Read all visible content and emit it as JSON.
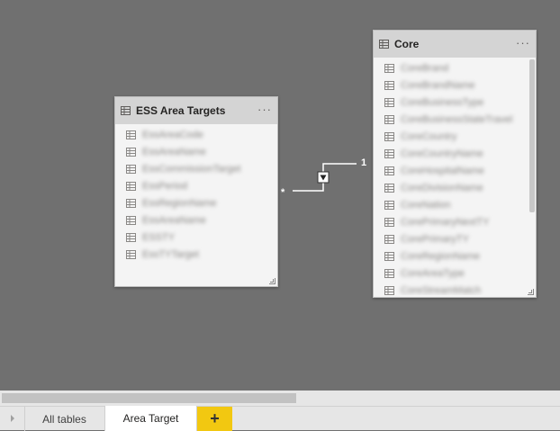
{
  "tables": [
    {
      "id": "ess",
      "title": "ESS Area Targets",
      "menu_label": "···",
      "fields": [
        "EssAreaCode",
        "EssAreaName",
        "EssCommissionTarget",
        "EssPeriod",
        "EssRegionName",
        "EssAreaName",
        "ESSTY",
        "EssTYTarget"
      ]
    },
    {
      "id": "core",
      "title": "Core",
      "menu_label": "···",
      "fields": [
        "CoreBrand",
        "CoreBrandName",
        "CoreBusinessType",
        "CoreBusinessStateTravel",
        "CoreCountry",
        "CoreCountryName",
        "CoreHospitalName",
        "CoreDivisionName",
        "CoreNation",
        "CorePrimaryNextTY",
        "CorePrimaryTY",
        "CoreRegionName",
        "CoreAreaType",
        "CoreStreamMatch"
      ]
    }
  ],
  "relationship": {
    "many_label": "*",
    "one_label": "1"
  },
  "tabs": {
    "all_tables": "All tables",
    "area_target": "Area Target",
    "add": "+"
  },
  "colors": {
    "canvas": "#707070",
    "card_header": "#d4d4d4",
    "add_tab": "#f2c811"
  }
}
